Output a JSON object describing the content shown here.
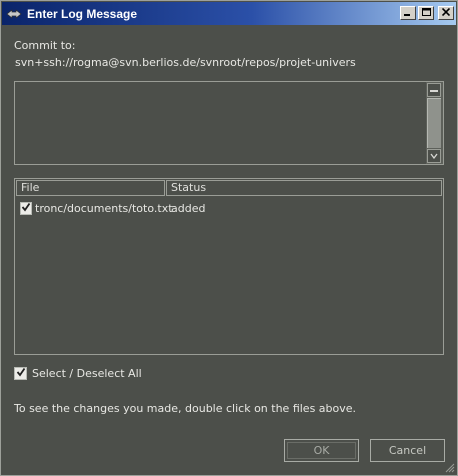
{
  "window": {
    "title": "Enter Log Message",
    "controls": {
      "minimize": "_",
      "maximize": "□",
      "close": "✕"
    }
  },
  "commit": {
    "label": "Commit to:",
    "url": "svn+ssh://rogma@svn.berlios.de/svnroot/repos/projet-univers"
  },
  "message": {
    "value": ""
  },
  "table": {
    "columns": [
      "File",
      "Status"
    ],
    "rows": [
      {
        "file": "tronc/documents/toto.txt",
        "status": "added",
        "checked": true
      }
    ]
  },
  "select_all": {
    "label": "Select / Deselect All",
    "checked": true
  },
  "hint": "To see the changes you made, double click on the files above.",
  "buttons": {
    "ok": "OK",
    "cancel": "Cancel"
  },
  "colors": {
    "background": "#4c4f4a",
    "text": "#e8e8e4",
    "titlebar_start": "#0a246a",
    "titlebar_end": "#a6caf0"
  }
}
